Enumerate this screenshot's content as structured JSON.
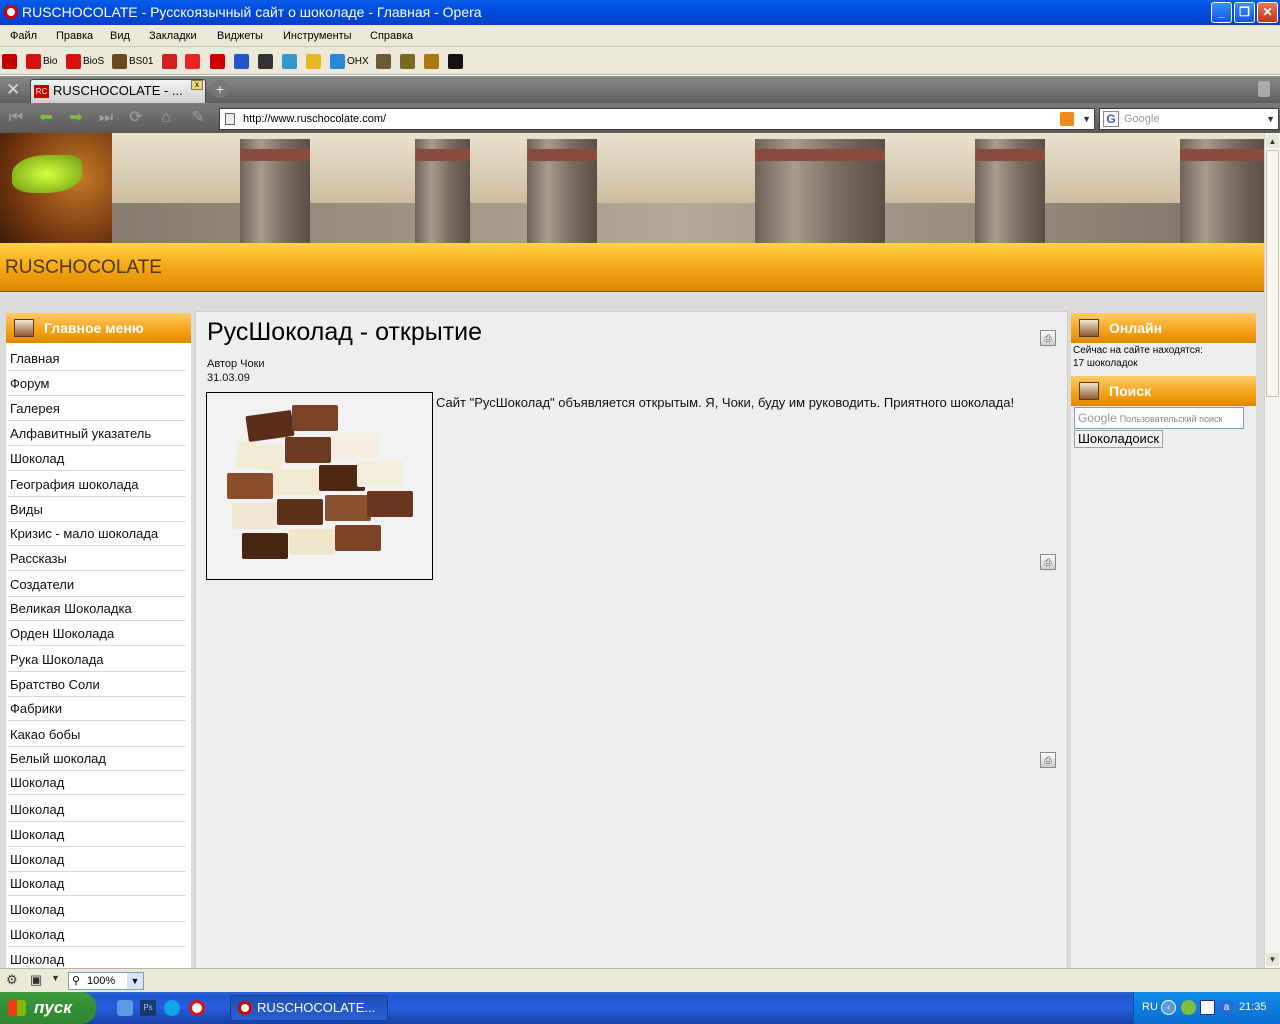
{
  "window": {
    "title": "RUSCHOCOLATE - Русскоязычный сайт о шоколаде - Главная - Opera"
  },
  "menu": [
    "Файл",
    "Правка",
    "Вид",
    "Закладки",
    "Виджеты",
    "Инструменты",
    "Справка"
  ],
  "bookmarks": [
    {
      "label": "",
      "color": "#c00000"
    },
    {
      "label": "Bio",
      "color": "#d81010"
    },
    {
      "label": "BioS",
      "color": "#d81010"
    },
    {
      "label": "BS01",
      "color": "#6a4a20"
    },
    {
      "label": "",
      "color": "#cc2222"
    },
    {
      "label": "",
      "color": "#ee2222"
    },
    {
      "label": "",
      "color": "#cc0000"
    },
    {
      "label": "",
      "color": "#2255cc"
    },
    {
      "label": "",
      "color": "#333333"
    },
    {
      "label": "",
      "color": "#3399cc"
    },
    {
      "label": "",
      "color": "#e8b820"
    },
    {
      "label": "OHX",
      "color": "#2a88d8"
    },
    {
      "label": "",
      "color": "#6a5a3a"
    },
    {
      "label": "",
      "color": "#7a6a20"
    },
    {
      "label": "",
      "color": "#aa7a10"
    },
    {
      "label": "",
      "color": "#111111"
    }
  ],
  "tab": {
    "label": "RUSCHOCOLATE - ..."
  },
  "address": {
    "url": "http://www.ruschocolate.com/",
    "search_placeholder": "Google"
  },
  "site": {
    "name": "RUSCHOCOLATE"
  },
  "left_menu": {
    "title": "Главное меню",
    "items": [
      "Главная",
      "Форум",
      "Галерея",
      "Алфавитный указатель",
      "Шоколад",
      "География шоколада",
      "Виды",
      "Кризис - мало шоколада",
      "Рассказы",
      "Создатели",
      "Великая Шоколадка",
      "Орден Шоколада",
      "Рука Шоколада",
      "Братство Соли",
      "Фабрики",
      "Какао бобы",
      "Белый шоколад",
      "Шоколад",
      "Шоколад",
      "Шоколад",
      "Шоколад",
      "Шоколад",
      "Шоколад",
      "Шоколад",
      "Шоколад"
    ]
  },
  "article": {
    "title": "РусШоколад - открытие",
    "author": "Автор Чоки",
    "date": "31.03.09",
    "body": "Сайт \"РусШоколад\" объявляется открытым. Я, Чоки, буду им руководить. Приятного шоколада!"
  },
  "online": {
    "title": "Онлайн",
    "line1": "Сейчас на сайте находятся:",
    "line2": "17 шоколадок"
  },
  "search": {
    "title": "Поиск",
    "placeholder": "Пользовательский поиск",
    "google_label": "Google",
    "button": "Шоколадоиск"
  },
  "status": {
    "zoom": "100%"
  },
  "taskbar": {
    "start": "пуск",
    "window": "RUSCHOCOLATE...",
    "lang": "RU",
    "clock": "21:35"
  }
}
